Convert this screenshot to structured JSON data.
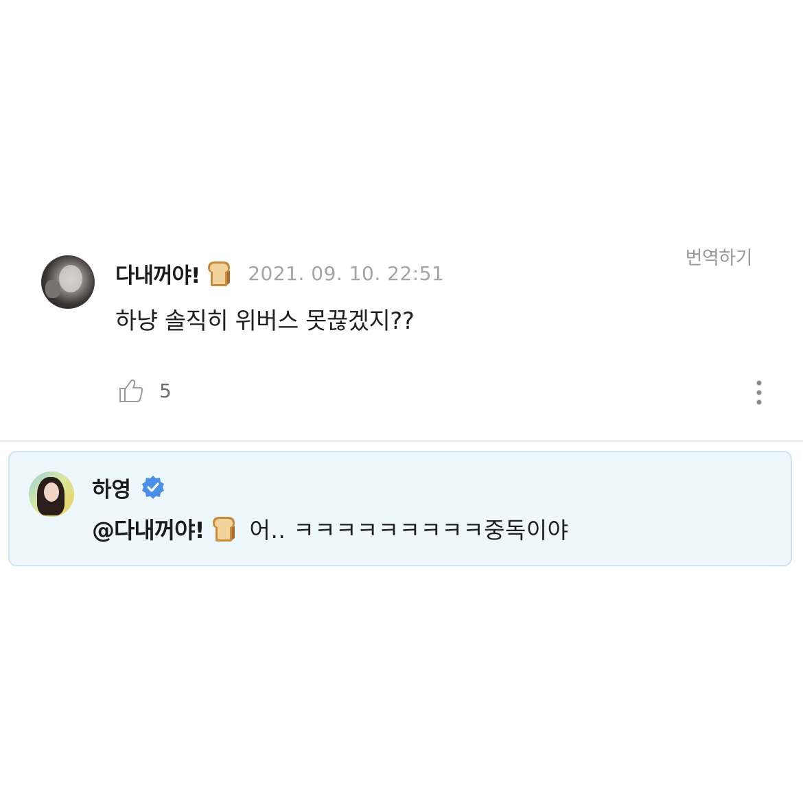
{
  "comment": {
    "username": "다내꺼야!",
    "username_emoji": "bread-icon",
    "timestamp": "2021. 09. 10. 22:51",
    "translate_label": "번역하기",
    "body": "하냥 솔직히 위버스 못끊겠지??",
    "like_count": "5",
    "like_icon": "thumbs-up-icon",
    "more_icon": "more-vertical-icon"
  },
  "reply": {
    "username": "하영",
    "verified_icon": "verified-badge-icon",
    "mention": "@다내꺼야!",
    "mention_emoji": "bread-icon",
    "body": "어.. ㅋㅋㅋㅋㅋㅋㅋㅋㅋ중독이야"
  },
  "colors": {
    "reply_background": "#eef7fc",
    "reply_border": "#cde5f1",
    "verified_blue": "#4a8fe7",
    "muted_text": "#a4a4a4"
  }
}
